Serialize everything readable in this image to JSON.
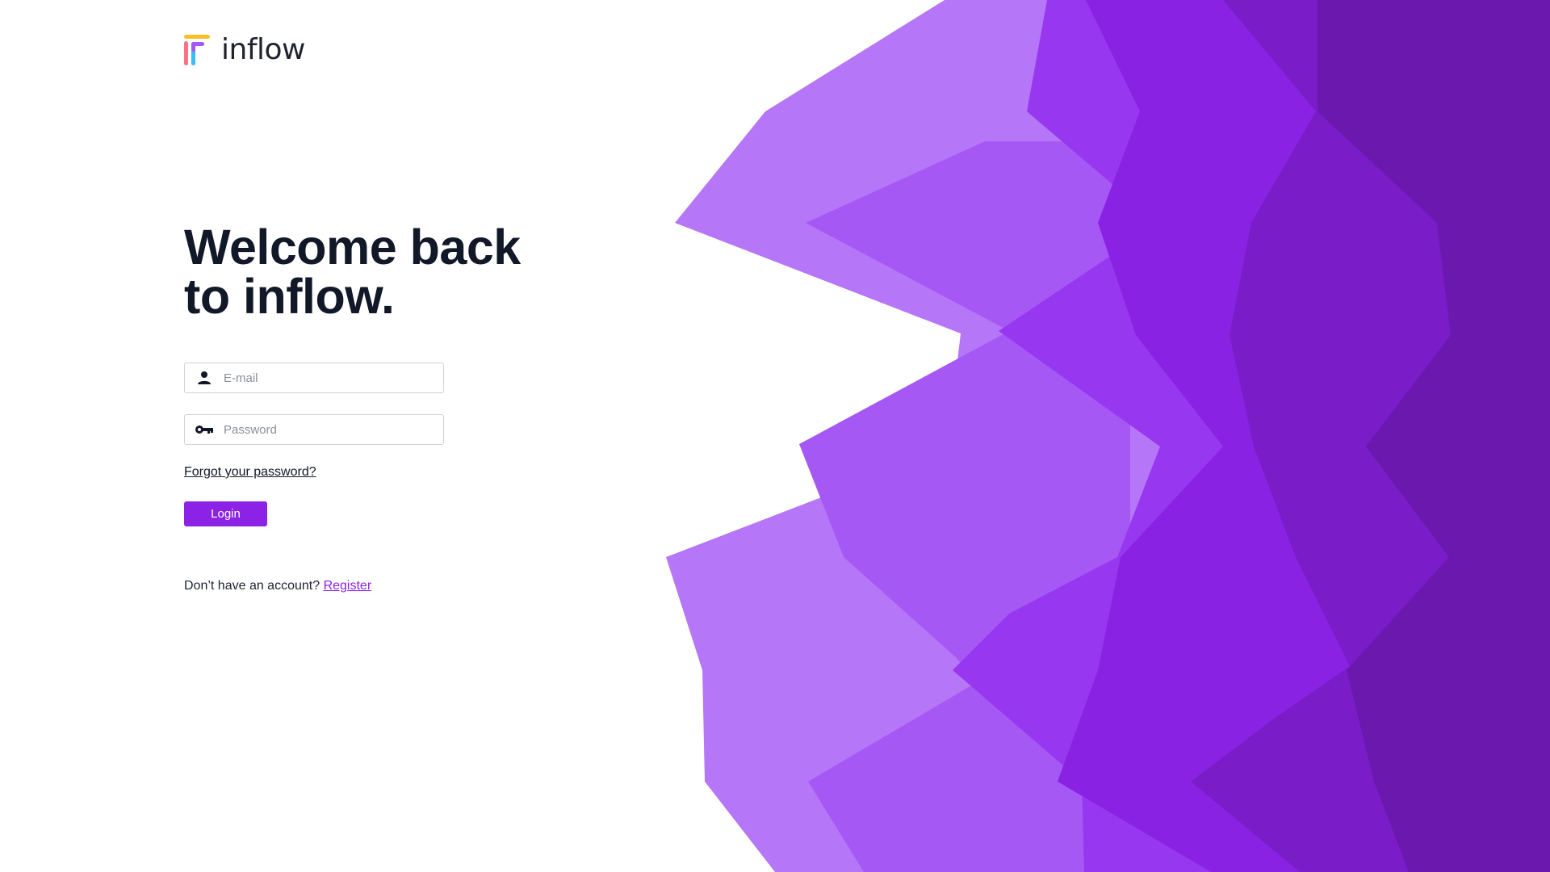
{
  "brand": {
    "name": "inflow",
    "accent_color": "#8b22e6",
    "logo_colors": [
      "#fbbf24",
      "#fb7185",
      "#a855f7",
      "#38bdf8"
    ]
  },
  "hero": {
    "headline_line1": "Welcome back",
    "headline_line2": "to inflow."
  },
  "form": {
    "email": {
      "icon": "person-icon",
      "placeholder": "E-mail",
      "value": ""
    },
    "password": {
      "icon": "key-icon",
      "placeholder": "Password",
      "value": ""
    },
    "forgot_label": "Forgot your password?",
    "login_label": "Login"
  },
  "footer": {
    "prompt": "Don’t have an account?",
    "register_label": "Register"
  },
  "background": {
    "palette": [
      "#b676f8",
      "#a658f5",
      "#9738f0",
      "#8a22e4",
      "#7a1cc8",
      "#6a18ae"
    ]
  }
}
